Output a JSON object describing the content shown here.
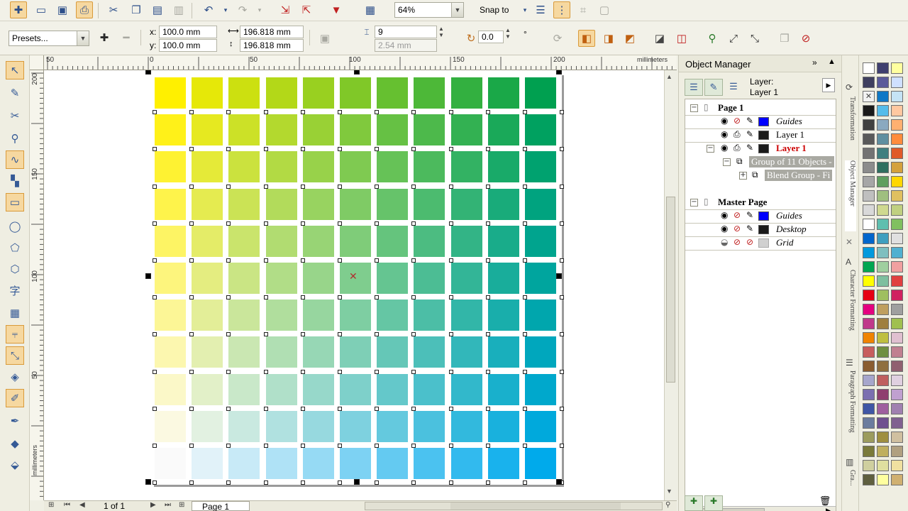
{
  "toolbar": {
    "zoom": "64%",
    "snap_to": "Snap to",
    "presets": "Presets...",
    "x_label": "x:",
    "y_label": "y:",
    "x_value": "100.0 mm",
    "y_value": "100.0 mm",
    "width_value": "196.818 mm",
    "height_value": "196.818 mm",
    "steps_value": "9",
    "spacing_value": "2.54 mm",
    "angle_value": "0.0",
    "degree": "°"
  },
  "ruler": {
    "unit": "millimeters",
    "h_labels": [
      "50",
      "0",
      "50",
      "100",
      "150",
      "200"
    ],
    "v_labels": [
      "200",
      "150",
      "100",
      "50"
    ]
  },
  "status": {
    "page_count": "1 of 1",
    "page_tab": "Page 1"
  },
  "object_manager": {
    "title": "Object Manager",
    "layer_label": "Layer:",
    "layer_name": "Layer 1",
    "rows": {
      "page1": "Page 1",
      "guides": "Guides",
      "layer1": "Layer 1",
      "layer1_active": "Layer 1",
      "group": "Group of 11 Objects - ",
      "blend": "Blend Group - Fi",
      "master": "Master Page",
      "m_guides": "Guides",
      "m_desktop": "Desktop",
      "m_grid": "Grid"
    }
  },
  "side_tabs": [
    "Transformation",
    "Object Manager",
    "Character Formatting",
    "Paragraph Formatting",
    "Gra..."
  ],
  "colors": {
    "accent": "#f6d8a0",
    "active_layer": "#cc0000",
    "guides_blue": "#0000ff"
  }
}
